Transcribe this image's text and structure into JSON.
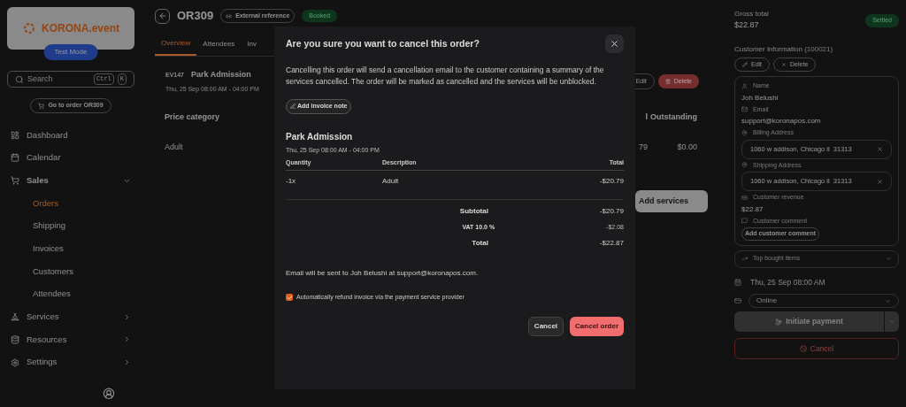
{
  "sidebar": {
    "logo": "KORONA.event",
    "test_mode": "Test Mode",
    "search": {
      "placeholder": "Search",
      "keys": [
        "Ctrl",
        "K"
      ]
    },
    "goto_button": "Go to order OR309",
    "nav": [
      {
        "label": "Dashboard",
        "kind": "link",
        "selected": false
      },
      {
        "label": "Calendar",
        "kind": "link",
        "selected": false
      },
      {
        "label": "Sales",
        "kind": "group",
        "expanded": true,
        "selected": false,
        "children": [
          {
            "label": "Orders",
            "selected": true
          },
          {
            "label": "Shipping",
            "selected": false
          },
          {
            "label": "Invoices",
            "selected": false
          },
          {
            "label": "Customers",
            "selected": false
          },
          {
            "label": "Attendees",
            "selected": false
          }
        ]
      },
      {
        "label": "Services",
        "kind": "group",
        "expanded": false,
        "selected": false
      },
      {
        "label": "Resources",
        "kind": "group",
        "expanded": false,
        "selected": false
      },
      {
        "label": "Settings",
        "kind": "group",
        "expanded": false,
        "selected": false
      }
    ]
  },
  "order": {
    "number": "OR309",
    "external_reference": "External reference",
    "status": "Booked",
    "tabs": [
      {
        "label": "Overview",
        "selected": true
      },
      {
        "label": "Attendees",
        "selected": false
      },
      {
        "label": "Inv",
        "selected": false
      }
    ],
    "service": {
      "code": "EV147",
      "name": "Park Admission",
      "date": "Thu, 25 Sep 08:00 AM - 04:00 PM",
      "edit": "Edit",
      "delete": "Delete"
    },
    "table": {
      "columns": [
        "Price category",
        "l",
        "Outstanding"
      ],
      "rows": [
        [
          "Adult",
          "79",
          "$0.00"
        ]
      ]
    },
    "add_services": "Add services"
  },
  "summary": {
    "gross_total_label": "Gross total",
    "gross_total": "$22.87",
    "payment_status": "Settled",
    "customer": {
      "title": "Customer Information",
      "id": "(100021)",
      "edit": "Edit",
      "delete": "Delete",
      "fields": [
        {
          "label": "Name",
          "value": "Joh Belushi",
          "kind": "text"
        },
        {
          "label": "Email",
          "value": "support@koronapos.com",
          "kind": "text"
        },
        {
          "label": "Billing Address",
          "value": "1060 w addison, Chicago il  31313",
          "kind": "address"
        },
        {
          "label": "Shipping Address",
          "value": "1060 w addison, Chicago il  31313",
          "kind": "address"
        },
        {
          "label": "Customer revenue",
          "value": "$22.87",
          "kind": "text"
        },
        {
          "label": "Customer comment",
          "value": "Add customer comment",
          "kind": "button"
        }
      ]
    },
    "top_items": {
      "label": "Top bought items",
      "expanded": false
    },
    "date": "Thu, 25 Sep 08:00 AM",
    "payment_method": "Online",
    "initiate_payment": "Initiate payment",
    "cancel": "Cancel"
  },
  "dialog": {
    "title": "Are you sure you want to cancel this order?",
    "message": "Cancelling this order will send a cancellation email to the customer containing a summary of the services cancelled. The order will be marked as cancelled and the services will be unblocked.",
    "add_note": "Add invoice note",
    "service_name": "Park Admission",
    "service_date": "Thu, 25 Sep 08:00 AM - 04:00 PM",
    "columns": [
      "Quantity",
      "Description",
      "Total"
    ],
    "rows": [
      [
        "-1x",
        "Adult",
        "-$20.79"
      ]
    ],
    "totals": [
      {
        "label": "Subtotal",
        "value": "-$20.79",
        "kind": "main"
      },
      {
        "label": "VAT 10.0 %",
        "value": "-$2.08",
        "kind": "minor"
      },
      {
        "label": "Total",
        "value": "-$22.87",
        "kind": "main"
      }
    ],
    "email_note": "Email will be sent to Joh Belushi at support@koronapos.com.",
    "refund": {
      "label": "Automatically refund invoice via the payment service provider",
      "checked": true
    },
    "buttons": [
      {
        "label": "Cancel",
        "kind": "secondary"
      },
      {
        "label": "Cancel order",
        "kind": "danger"
      }
    ]
  }
}
